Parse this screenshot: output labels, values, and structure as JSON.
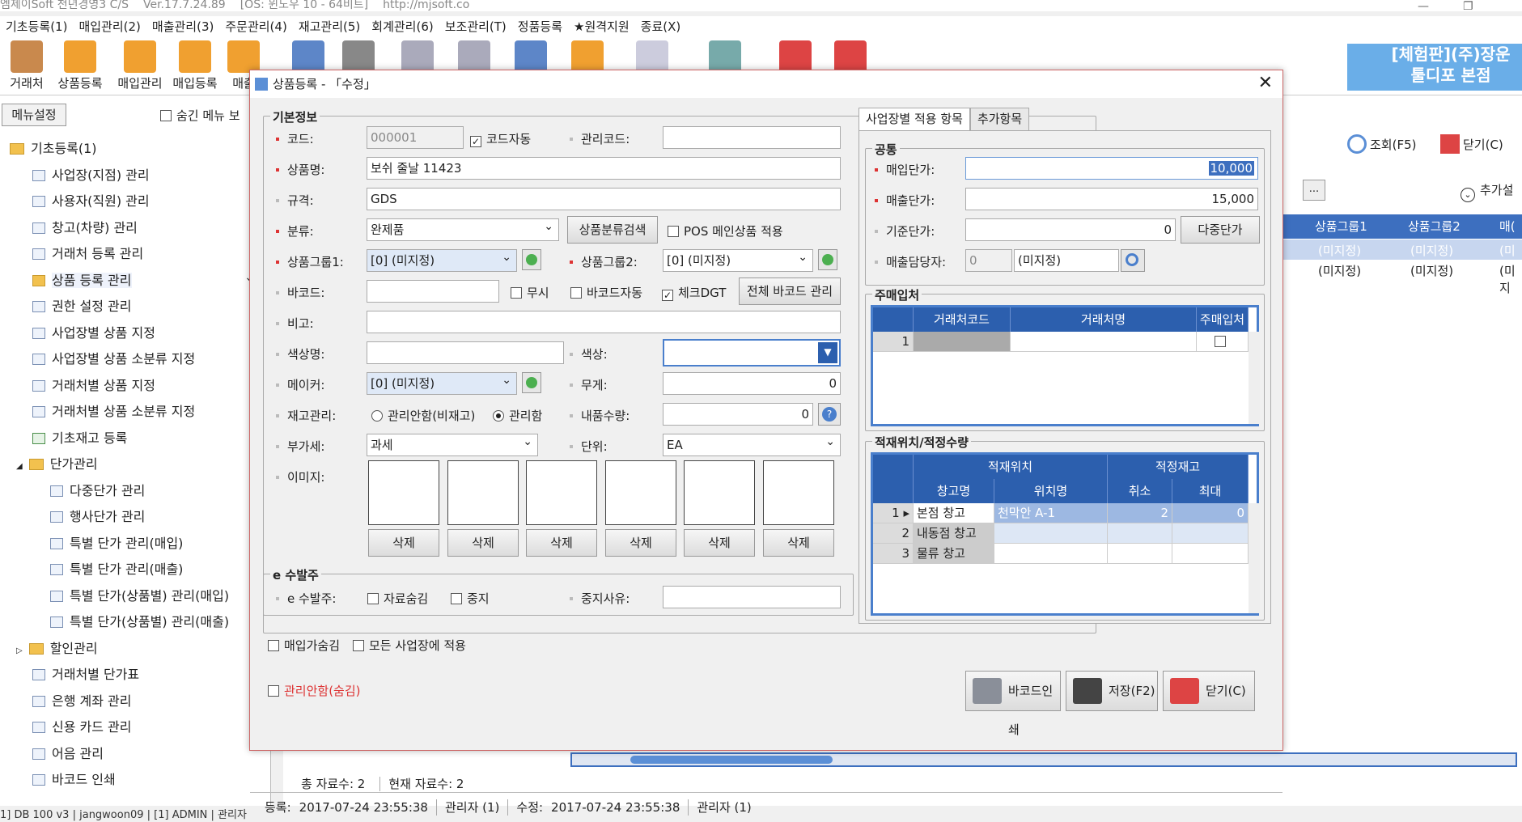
{
  "window": {
    "title_parts": [
      "엠제이Soft 천년경영3 C/S",
      "Ver.17.7.24.89",
      "[OS: 윈도우 10 - 64비트]",
      "http://mjsoft.co"
    ],
    "minimize": "—",
    "restore": "❐"
  },
  "menu": [
    "기초등록(1)",
    "매입관리(2)",
    "매출관리(3)",
    "주문관리(4)",
    "재고관리(5)",
    "회계관리(6)",
    "보조관리(T)",
    "정품등록",
    "★원격지원",
    "종료(X)"
  ],
  "toolbar": {
    "items": [
      "거래처",
      "상품등록",
      "매입관리",
      "매입등록",
      "매출"
    ]
  },
  "demo_banner": {
    "line1": "[체험판](주)장운",
    "line2": "툴디포 본점"
  },
  "left_panel": {
    "menu_settings": "메뉴설정",
    "hide_menu": "숨긴 메뉴 보",
    "tree": [
      {
        "label": "기초등록(1)",
        "type": "folder",
        "level": 0
      },
      {
        "label": "사업장(지점) 관리",
        "type": "item",
        "level": 1
      },
      {
        "label": "사용자(직원) 관리",
        "type": "item",
        "level": 1
      },
      {
        "label": "창고(차량) 관리",
        "type": "item",
        "level": 1
      },
      {
        "label": "거래처 등록 관리",
        "type": "item",
        "level": 1
      },
      {
        "label": "상품 등록 관리",
        "type": "item",
        "level": 1,
        "selected": true
      },
      {
        "label": "권한 설정 관리",
        "type": "item",
        "level": 1
      },
      {
        "label": "사업장별 상품 지정",
        "type": "item",
        "level": 1
      },
      {
        "label": "사업장별 상품 소분류 지정",
        "type": "item",
        "level": 1
      },
      {
        "label": "거래처별 상품 지정",
        "type": "item",
        "level": 1
      },
      {
        "label": "거래처별 상품 소분류 지정",
        "type": "item",
        "level": 1
      },
      {
        "label": "기초재고 등록",
        "type": "item",
        "level": 1
      },
      {
        "label": "단가관리",
        "type": "folder",
        "level": 1
      },
      {
        "label": "다중단가 관리",
        "type": "item",
        "level": 2
      },
      {
        "label": "행사단가 관리",
        "type": "item",
        "level": 2
      },
      {
        "label": "특별 단가 관리(매입)",
        "type": "item",
        "level": 2
      },
      {
        "label": "특별 단가 관리(매출)",
        "type": "item",
        "level": 2
      },
      {
        "label": "특별 단가(상품별) 관리(매입)",
        "type": "item",
        "level": 2
      },
      {
        "label": "특별 단가(상품별) 관리(매출)",
        "type": "item",
        "level": 2
      },
      {
        "label": "할인관리",
        "type": "folder",
        "level": 1
      },
      {
        "label": "거래처별 단가표",
        "type": "item",
        "level": 1
      },
      {
        "label": "은행 계좌 관리",
        "type": "item",
        "level": 1
      },
      {
        "label": "신용 카드 관리",
        "type": "item",
        "level": 1
      },
      {
        "label": "어음 관리",
        "type": "item",
        "level": 1
      },
      {
        "label": "바코드 인쇄",
        "type": "item",
        "level": 1
      }
    ]
  },
  "right_panel": {
    "search_btn": "조회(F5)",
    "close_btn": "닫기(C)",
    "more_settings": "추가설",
    "grid_headers": [
      "상품그룹1",
      "상품그룹2",
      "매("
    ],
    "grid_rows": [
      [
        "(미지정)",
        "(미지정)",
        "(미지"
      ],
      [
        "(미지정)",
        "(미지정)",
        "(미지"
      ]
    ],
    "totals": "총 자료수: 2",
    "current": "현재 자료수: 2"
  },
  "status_bar": [
    "1] DB 100 v3",
    "jangwoon09",
    "[1] ADMIN",
    "관리자"
  ],
  "dialog": {
    "title": "상품등록 - 「수정」",
    "basic_info": "기본정보",
    "fields": {
      "code_label": "코드:",
      "code_value": "000001",
      "code_auto": "코드자동",
      "mgmt_code_label": "관리코드:",
      "mgmt_code_value": "",
      "name_label": "상품명:",
      "name_value": "보쉬 줄날 11423",
      "spec_label": "규격:",
      "spec_value": "GDS",
      "category_label": "분류:",
      "category_value": "완제품",
      "category_search": "상품분류검색",
      "pos_main": "POS 메인상품 적용",
      "group1_label": "상품그룹1:",
      "group1_value": "[0] (미지정)",
      "group2_label": "상품그룹2:",
      "group2_value": "[0] (미지정)",
      "barcode_label": "바코드:",
      "barcode_value": "",
      "musi": "무시",
      "barcode_auto": "바코드자동",
      "check_dgt": "체크DGT",
      "all_barcode": "전체 바코드 관리",
      "memo_label": "비고:",
      "memo_value": "",
      "color_name_label": "색상명:",
      "color_name_value": "",
      "color_label": "색상:",
      "maker_label": "메이커:",
      "maker_value": "[0] (미지정)",
      "weight_label": "무게:",
      "weight_value": "0",
      "stock_label": "재고관리:",
      "stock_opt1": "관리안함(비재고)",
      "stock_opt2": "관리함",
      "content_qty_label": "내품수량:",
      "content_qty_value": "0",
      "vat_label": "부가세:",
      "vat_value": "과세",
      "unit_label": "단위:",
      "unit_value": "EA",
      "image_label": "이미지:",
      "delete": "삭제"
    },
    "e_order": {
      "title": "e 수발주",
      "label": "e 수발주:",
      "data_hide": "자료숨김",
      "stop": "중지",
      "stop_reason_label": "중지사유:",
      "stop_reason_value": ""
    },
    "purchase_hide": "매입가숨김",
    "all_branches": "모든 사업장에 적용",
    "not_managed": "관리안함(숨김)",
    "tabs": [
      "사업장별 적용 항목",
      "추가항목"
    ],
    "common": {
      "title": "공통",
      "purchase_price_label": "매입단가:",
      "purchase_price": "10,000",
      "sale_price_label": "매출단가:",
      "sale_price": "15,000",
      "base_price_label": "기준단가:",
      "base_price": "0",
      "multi_price": "다중단가",
      "sales_rep_label": "매출담당자:",
      "sales_rep_code": "0",
      "sales_rep_name": "(미지정)"
    },
    "main_vendor": {
      "title": "주매입처",
      "headers": [
        "거래처코드",
        "거래처명",
        "주매입처"
      ],
      "rows": [
        [
          "1",
          "",
          ""
        ]
      ]
    },
    "location": {
      "title": "적재위치/적정수량",
      "group_headers": [
        "적재위치",
        "적정재고"
      ],
      "headers": [
        "창고명",
        "위치명",
        "취소",
        "최대"
      ],
      "rows": [
        [
          "1",
          "본점 창고",
          "천막안 A-1",
          "2",
          "0"
        ],
        [
          "2",
          "내동점 창고",
          "",
          "",
          ""
        ],
        [
          "3",
          "물류 창고",
          "",
          "",
          ""
        ]
      ]
    },
    "buttons": {
      "barcode_print": "바코드인쇄",
      "save": "저장(F2)",
      "close": "닫기(C)"
    },
    "status": {
      "reg_label": "등록:",
      "reg_date": "2017-07-24 23:55:38",
      "reg_user": "관리자 (1)",
      "mod_label": "수정:",
      "mod_date": "2017-07-24 23:55:38",
      "mod_user": "관리자 (1)"
    }
  }
}
